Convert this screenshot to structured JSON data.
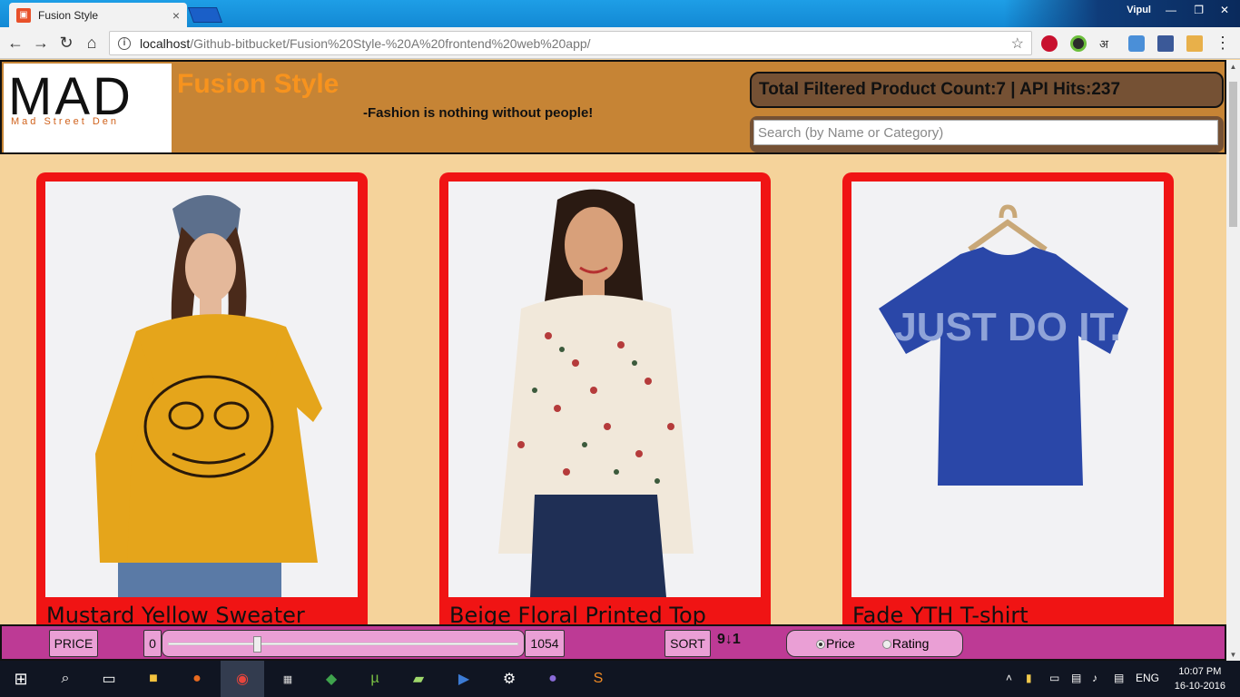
{
  "browser": {
    "tab_title": "Fusion Style",
    "tab_close": "×",
    "user": "Vipul",
    "url_host": "localhost",
    "url_path": "/Github-bitbucket/Fusion%20Style-%20A%20frontend%20web%20app/"
  },
  "header": {
    "logo_main": "MAD",
    "logo_sub": "Mad Street Den",
    "title": "Fusion Style",
    "tagline": "-Fashion is nothing without people!",
    "count_text": "Total Filtered Product Count:7 | API Hits:237",
    "search_placeholder": "Search (by Name or Category)"
  },
  "products": [
    {
      "name": "Mustard Yellow Sweater",
      "image": "woman-yellow-sweater"
    },
    {
      "name": "Beige Floral Printed Top",
      "image": "woman-floral-top"
    },
    {
      "name": "Fade YTH T-shirt",
      "image": "blue-tshirt-on-hanger",
      "print": "JUST DO IT."
    }
  ],
  "filters": {
    "price_label": "PRICE",
    "price_min": "0",
    "price_max": "1054",
    "slider_value": 0.25,
    "sort_label": "SORT",
    "sort_icon": "9↓1",
    "radio_price": "Price",
    "radio_rating": "Rating",
    "selected": "Price"
  },
  "taskbar": {
    "lang": "ENG",
    "time": "10:07 PM",
    "date": "16-10-2016"
  },
  "colors": {
    "header_bg": "#c68435",
    "title": "#f7931e",
    "card": "#f01414",
    "filterbar": "#bd3a95",
    "page_bg": "#f5d39b"
  }
}
